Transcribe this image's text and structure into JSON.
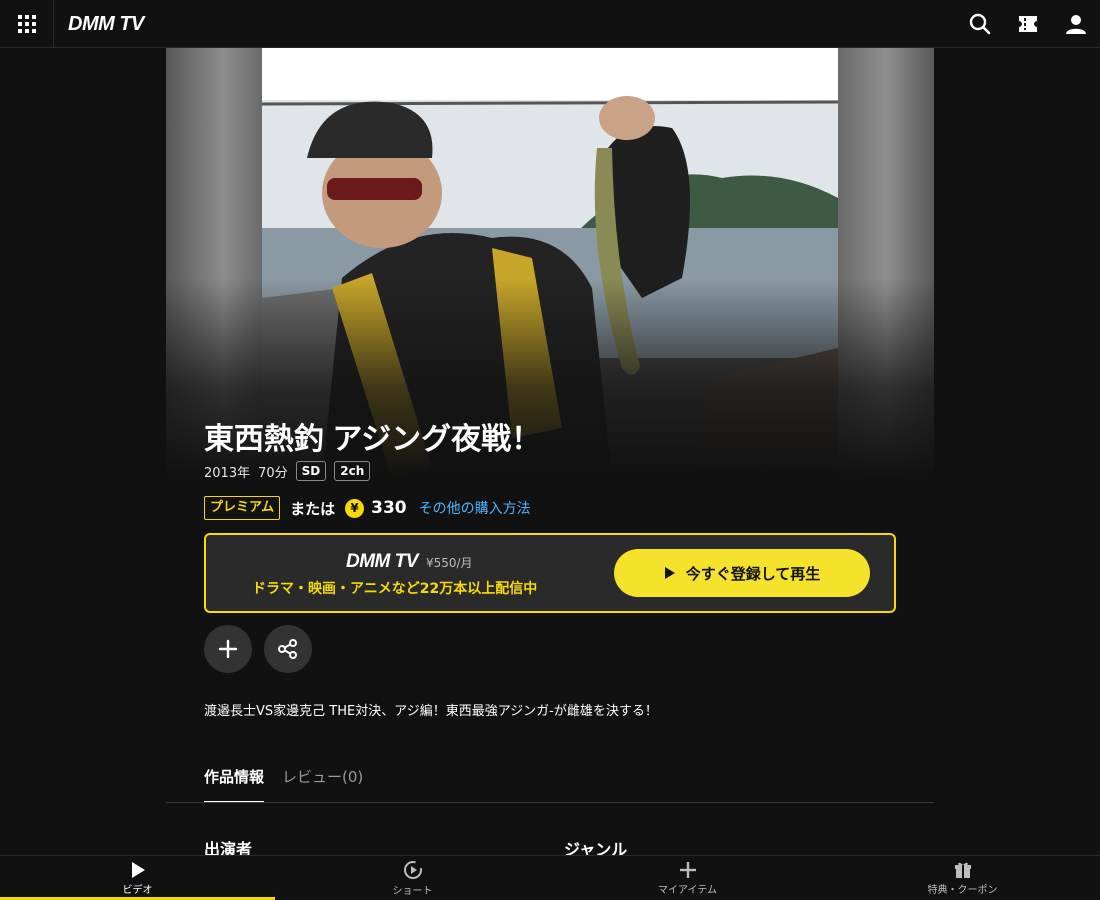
{
  "header": {
    "logo": "DMM TV",
    "icons": [
      "apps-grid-icon",
      "search-icon",
      "ticket-icon",
      "user-icon"
    ]
  },
  "hero": {
    "image_subject": "angler-holding-fish-photo"
  },
  "title": "東西熱釣 アジング夜戦！",
  "meta": {
    "year": "2013年",
    "duration": "70分",
    "badges": [
      "SD",
      "2ch"
    ]
  },
  "price": {
    "premium_label": "プレミアム",
    "or_label": "または",
    "coin_symbol": "¥",
    "amount": "330",
    "other_link": "その他の購入方法"
  },
  "subscribe": {
    "logo": "DMM TV",
    "monthly_price": "¥550/月",
    "tagline": "ドラマ・映画・アニメなど22万本以上配信中",
    "button_label": "今すぐ登録して再生"
  },
  "description": "渡邉長士VS家邊克己 THE対決、アジ編！東西最強アジンガ-が雌雄を決する！",
  "tabs": [
    {
      "label": "作品情報",
      "active": true
    },
    {
      "label": "レビュー(0)",
      "active": false
    }
  ],
  "sections": {
    "cast": "出演者",
    "genre": "ジャンル"
  },
  "bottom_nav": [
    {
      "label": "ビデオ",
      "icon": "play-icon",
      "active": true
    },
    {
      "label": "ショート",
      "icon": "short-play-icon",
      "active": false
    },
    {
      "label": "マイアイテム",
      "icon": "plus-icon",
      "active": false
    },
    {
      "label": "特典・クーポン",
      "icon": "gift-icon",
      "active": false
    }
  ],
  "colors": {
    "background": "#111111",
    "accent": "#f5d90a",
    "link": "#4fb4ff",
    "button": "#f5e22a"
  }
}
